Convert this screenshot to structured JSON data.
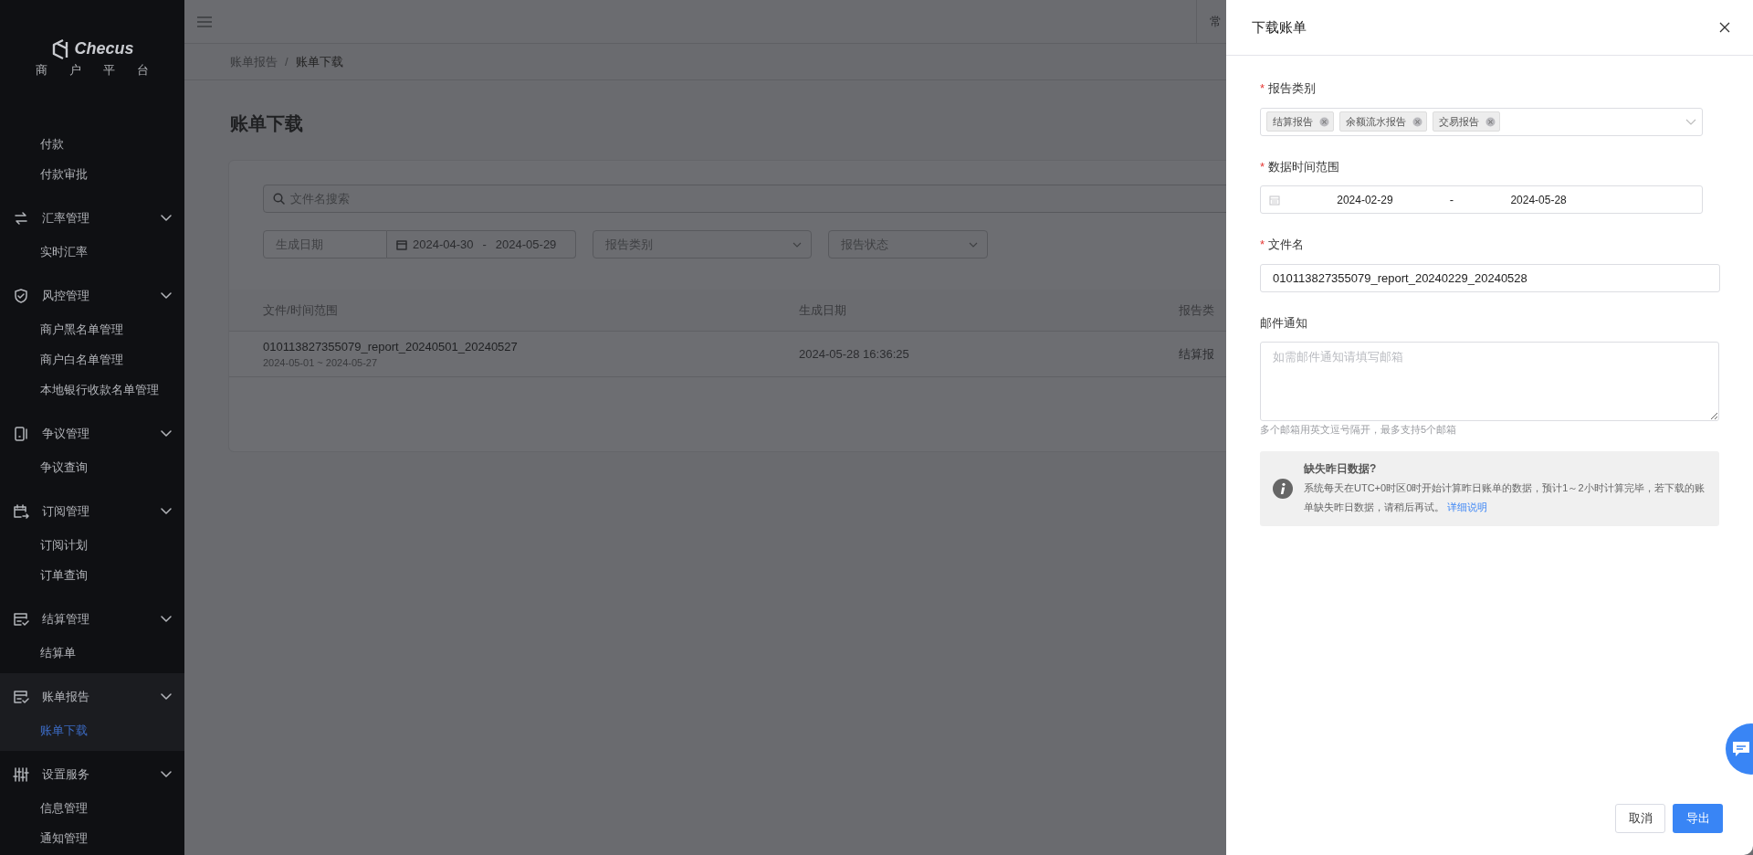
{
  "sidebar": {
    "logo": {
      "name": "Checus",
      "subtitle": "商户平台"
    },
    "groups": [
      {
        "children": [
          {
            "label": "付款",
            "selected": false
          },
          {
            "label": "付款审批",
            "selected": false
          }
        ]
      },
      {
        "label": "汇率管理",
        "kind": "exchange",
        "expanded": true,
        "selected": false,
        "children": [
          {
            "label": "实时汇率",
            "selected": false
          }
        ]
      },
      {
        "label": "风控管理",
        "kind": "shield",
        "expanded": true,
        "selected": false,
        "children": [
          {
            "label": "商户黑名单管理",
            "selected": false
          },
          {
            "label": "商户白名单管理",
            "selected": false
          },
          {
            "label": "本地银行收款名单管理",
            "selected": false
          }
        ]
      },
      {
        "label": "争议管理",
        "kind": "phone",
        "expanded": true,
        "selected": false,
        "children": [
          {
            "label": "争议查询",
            "selected": false
          }
        ]
      },
      {
        "label": "订阅管理",
        "kind": "calendar",
        "expanded": true,
        "selected": false,
        "children": [
          {
            "label": "订阅计划",
            "selected": false
          },
          {
            "label": "订单查询",
            "selected": false
          }
        ]
      },
      {
        "label": "结算管理",
        "kind": "bill",
        "expanded": true,
        "selected": false,
        "children": [
          {
            "label": "结算单",
            "selected": false
          }
        ]
      },
      {
        "label": "账单报告",
        "kind": "bill",
        "expanded": true,
        "selected": true,
        "children": [
          {
            "label": "账单下载",
            "selected": true
          }
        ]
      },
      {
        "label": "设置服务",
        "kind": "sliders",
        "expanded": true,
        "selected": false,
        "children": [
          {
            "label": "信息管理",
            "selected": false
          },
          {
            "label": "通知管理",
            "selected": false
          }
        ]
      }
    ]
  },
  "header": {
    "right_text": "常"
  },
  "breadcrumb": {
    "separator": "/",
    "items": [
      "账单报告",
      "账单下载"
    ]
  },
  "page_title": "账单下载",
  "filters": {
    "search_placeholder": "文件名搜索",
    "date_label": "生成日期",
    "date_start": "2024-04-30",
    "date_separator": "-",
    "date_end": "2024-05-29",
    "type_placeholder": "报告类别",
    "status_placeholder": "报告状态"
  },
  "table": {
    "columns": [
      "文件/时间范围",
      "生成日期",
      "报告类"
    ],
    "rows": [
      {
        "file": "010113827355079_report_20240501_20240527",
        "range": "2024-05-01 ~ 2024-05-27",
        "date": "2024-05-28 16:36:25",
        "type": "结算报"
      }
    ]
  },
  "drawer": {
    "title": "下载账单",
    "required_mark": "*",
    "fields": [
      {
        "kind": "tags",
        "label": "报告类别",
        "required": true,
        "tags": [
          "结算报告",
          "余额流水报告",
          "交易报告"
        ]
      },
      {
        "kind": "daterange",
        "label": "数据时间范围",
        "required": true,
        "start": "2024-02-29",
        "separator": "-",
        "end": "2024-05-28"
      },
      {
        "kind": "text",
        "label": "文件名",
        "required": true,
        "value": "010113827355079_report_20240229_20240528"
      },
      {
        "kind": "textarea",
        "label": "邮件通知",
        "required": false,
        "placeholder": "如需邮件通知请填写邮箱",
        "hint": "多个邮箱用英文逗号隔开，最多支持5个邮箱"
      }
    ],
    "notice": {
      "title": "缺失昨日数据?",
      "body": "系统每天在UTC+0时区0时开始计算昨日账单的数据，预计1～2小时计算完毕，若下载的账单缺失昨日数据，请稍后再试。",
      "link": "详细说明"
    },
    "buttons": [
      {
        "label": "取消",
        "kind": "secondary"
      },
      {
        "label": "导出",
        "kind": "primary"
      }
    ]
  }
}
